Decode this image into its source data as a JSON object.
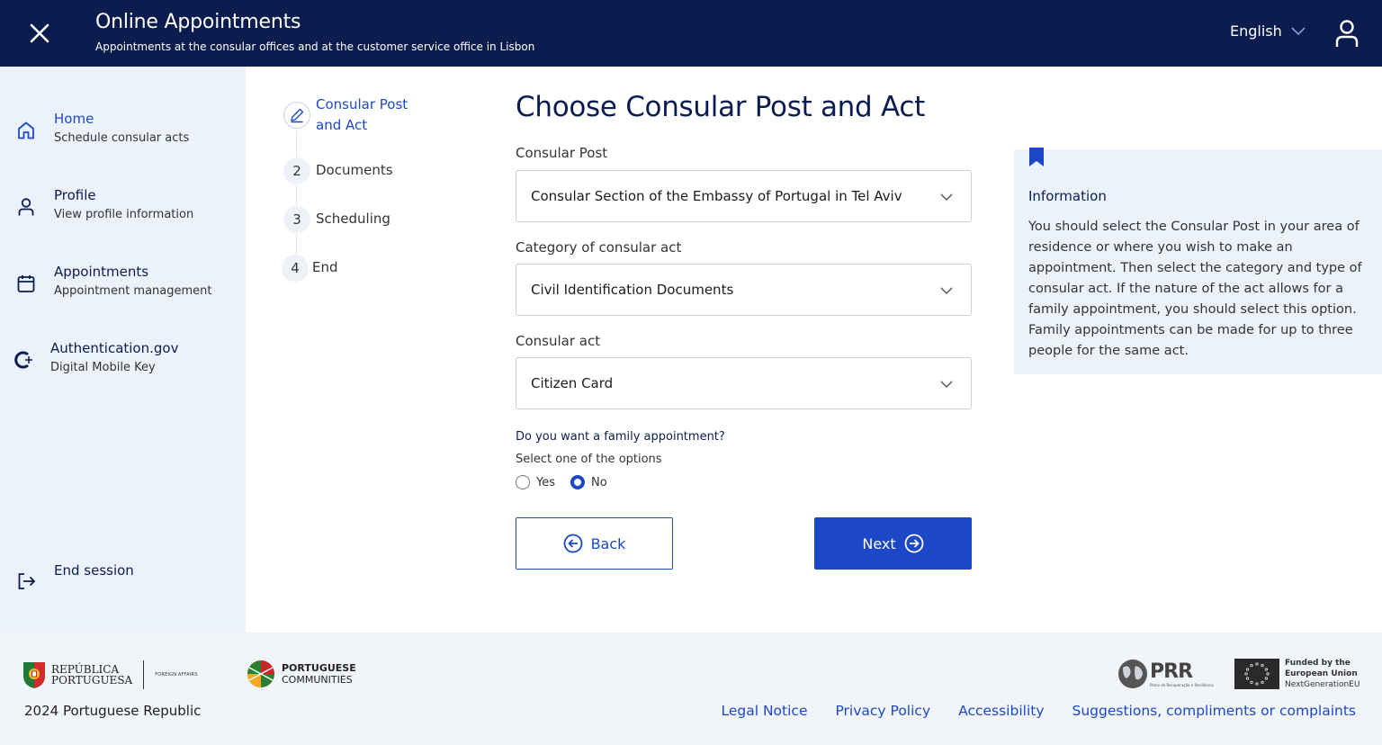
{
  "header": {
    "title": "Online Appointments",
    "subtitle": "Appointments at the consular offices and at the customer service office in Lisbon",
    "language": "English"
  },
  "sidebar": {
    "items": [
      {
        "label": "Home",
        "sub": "Schedule consular acts",
        "icon": "home-icon"
      },
      {
        "label": "Profile",
        "sub": "View profile information",
        "icon": "user-icon"
      },
      {
        "label": "Appointments",
        "sub": "Appointment management",
        "icon": "calendar-icon"
      },
      {
        "label": "Authentication.gov",
        "sub": "Digital Mobile Key",
        "icon": "key-icon"
      }
    ],
    "end_session": "End session"
  },
  "stepper": {
    "steps": [
      {
        "num": "",
        "label": "Consular Post and Act",
        "state": "active",
        "icon": "pencil-icon"
      },
      {
        "num": "2",
        "label": "Documents",
        "state": "pending"
      },
      {
        "num": "3",
        "label": "Scheduling",
        "state": "pending"
      },
      {
        "num": "4",
        "label": "End",
        "state": "pending"
      }
    ]
  },
  "form": {
    "title": "Choose Consular Post and Act",
    "consular_post_label": "Consular Post",
    "consular_post_value": "Consular Section of the Embassy of Portugal in Tel Aviv",
    "category_label": "Category of consular act",
    "category_value": "Civil Identification Documents",
    "act_label": "Consular act",
    "act_value": "Citizen Card",
    "family_question": "Do you want a family appointment?",
    "select_hint": "Select one of the options",
    "options": {
      "yes": "Yes",
      "no": "No"
    },
    "selected_option": "No",
    "back_label": "Back",
    "next_label": "Next"
  },
  "info": {
    "title": "Information",
    "text": "You should select the Consular Post in your area of residence or where you wish to make an appointment. Then select the category and type of consular act. If the nature of the act allows for a family appointment, you should select this option. Family appointments can be made for up to three people for the same act."
  },
  "footer": {
    "rp_line1": "REPÚBLICA",
    "rp_line2": "PORTUGUESA",
    "rp_dept": "FOREIGN AFFAIRS",
    "pc_line1": "PORTUGUESE",
    "pc_line2": "COMMUNITIES",
    "prr": "PRR",
    "prr_sub": "Plano de Recuperação e Resiliência",
    "eu_line1": "Funded by the",
    "eu_line2": "European Union",
    "eu_line3": "NextGenerationEU",
    "copyright": "2024 Portuguese Republic",
    "links": [
      "Legal Notice",
      "Privacy Policy",
      "Accessibility",
      "Suggestions, compliments or complaints"
    ]
  },
  "colors": {
    "header_bg": "#0b1d4f",
    "accent": "#1c48c8",
    "sidebar_bg": "#ecf2fc",
    "footer_bg": "#f1f4f9"
  }
}
